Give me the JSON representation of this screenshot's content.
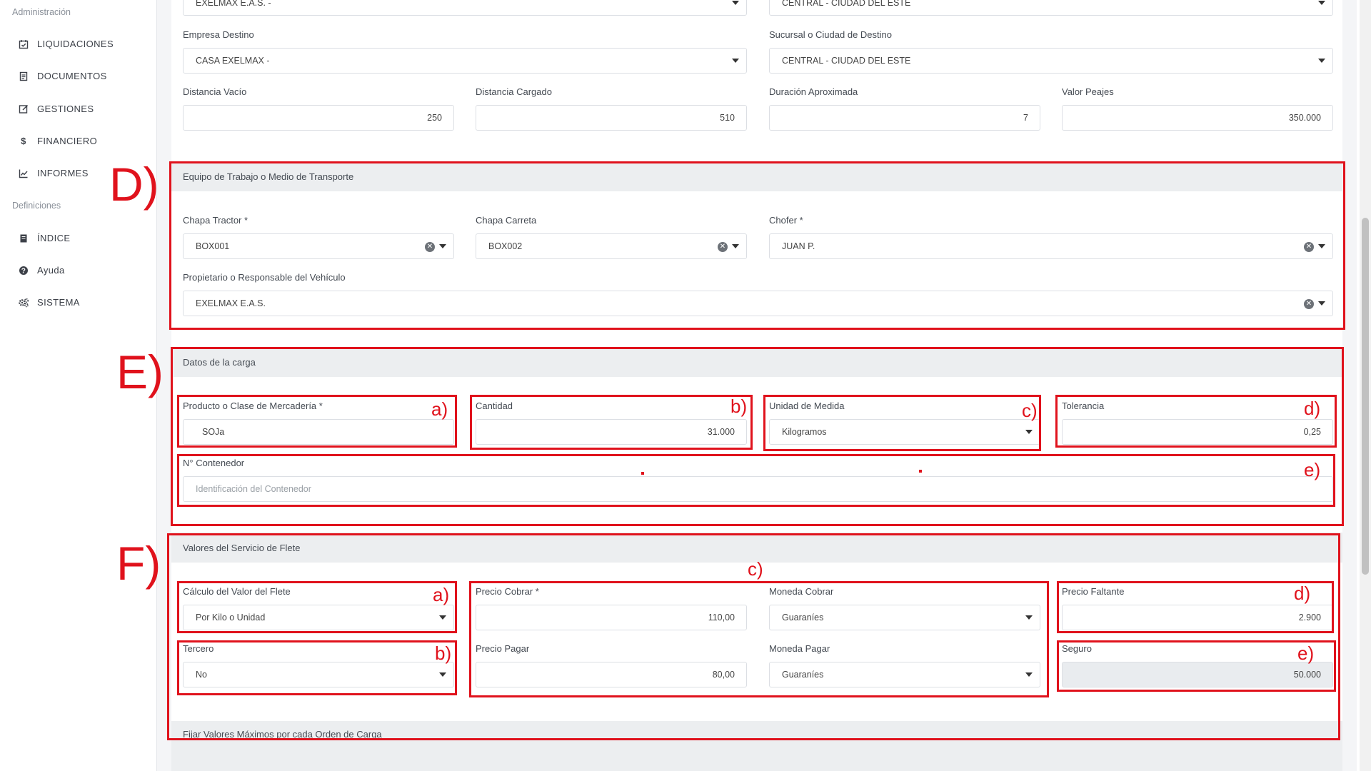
{
  "sidebar": {
    "section_admin": "Administración",
    "items_admin": [
      {
        "label": "LIQUIDACIONES",
        "icon": "calendar-check-icon"
      },
      {
        "label": "DOCUMENTOS",
        "icon": "document-icon"
      },
      {
        "label": "GESTIONES",
        "icon": "edit-square-icon"
      },
      {
        "label": "FINANCIERO",
        "icon": "dollar-icon"
      },
      {
        "label": "INFORMES",
        "icon": "chart-line-icon"
      }
    ],
    "section_defs": "Definiciones",
    "items_defs": [
      {
        "label": "ÍNDICE",
        "icon": "book-icon"
      },
      {
        "label": "Ayuda",
        "icon": "question-circle-icon"
      },
      {
        "label": "SISTEMA",
        "icon": "gears-icon"
      }
    ]
  },
  "route": {
    "empresa_origen": "EXELMAX E.A.S. -",
    "sucursal_origen": "CENTRAL - CIUDAD DEL ESTE",
    "empresa_destino_label": "Empresa Destino",
    "empresa_destino": "CASA EXELMAX -",
    "sucursal_destino_label": "Sucursal o Ciudad de Destino",
    "sucursal_destino": "CENTRAL - CIUDAD DEL ESTE",
    "distancia_vacio_label": "Distancia Vacío",
    "distancia_vacio": "250",
    "distancia_cargado_label": "Distancia Cargado",
    "distancia_cargado": "510",
    "duracion_label": "Duración Aproximada",
    "duracion": "7",
    "peajes_label": "Valor Peajes",
    "peajes": "350.000"
  },
  "equipo": {
    "title": "Equipo de Trabajo o Medio de Transporte",
    "chapa_tractor_label": "Chapa Tractor *",
    "chapa_tractor": "BOX001",
    "chapa_carreta_label": "Chapa Carreta",
    "chapa_carreta": "BOX002",
    "chofer_label": "Chofer *",
    "chofer": "JUAN P.",
    "propietario_label": "Propietario o Responsable del Vehículo",
    "propietario": "EXELMAX E.A.S."
  },
  "carga": {
    "title": "Datos de la carga",
    "producto_label": "Producto o Clase de Mercadería *",
    "producto": "SOJa",
    "cantidad_label": "Cantidad",
    "cantidad": "31.000",
    "unidad_label": "Unidad de Medida",
    "unidad": "Kilogramos",
    "tolerancia_label": "Tolerancia",
    "tolerancia": "0,25",
    "contenedor_label": "N° Contenedor",
    "contenedor_placeholder": "Identificación del Contenedor"
  },
  "flete": {
    "title": "Valores del Servicio de Flete",
    "calculo_label": "Cálculo del Valor del Flete",
    "calculo": "Por Kilo o Unidad",
    "tercero_label": "Tercero",
    "tercero": "No",
    "precio_cobrar_label": "Precio Cobrar *",
    "precio_cobrar": "110,00",
    "moneda_cobrar_label": "Moneda Cobrar",
    "moneda_cobrar": "Guaraníes",
    "precio_pagar_label": "Precio Pagar",
    "precio_pagar": "80,00",
    "moneda_pagar_label": "Moneda Pagar",
    "moneda_pagar": "Guaraníes",
    "precio_faltante_label": "Precio Faltante",
    "precio_faltante": "2.900",
    "seguro_label": "Seguro",
    "seguro": "50.000",
    "max_title": "Fijar Valores Máximos por cada Orden de Carga"
  },
  "annotations": {
    "D": "D)",
    "E": "E)",
    "F": "F)",
    "a": "a)",
    "b": "b)",
    "c": "c)",
    "d": "d)",
    "e": "e)",
    "color": "#e0121c"
  }
}
